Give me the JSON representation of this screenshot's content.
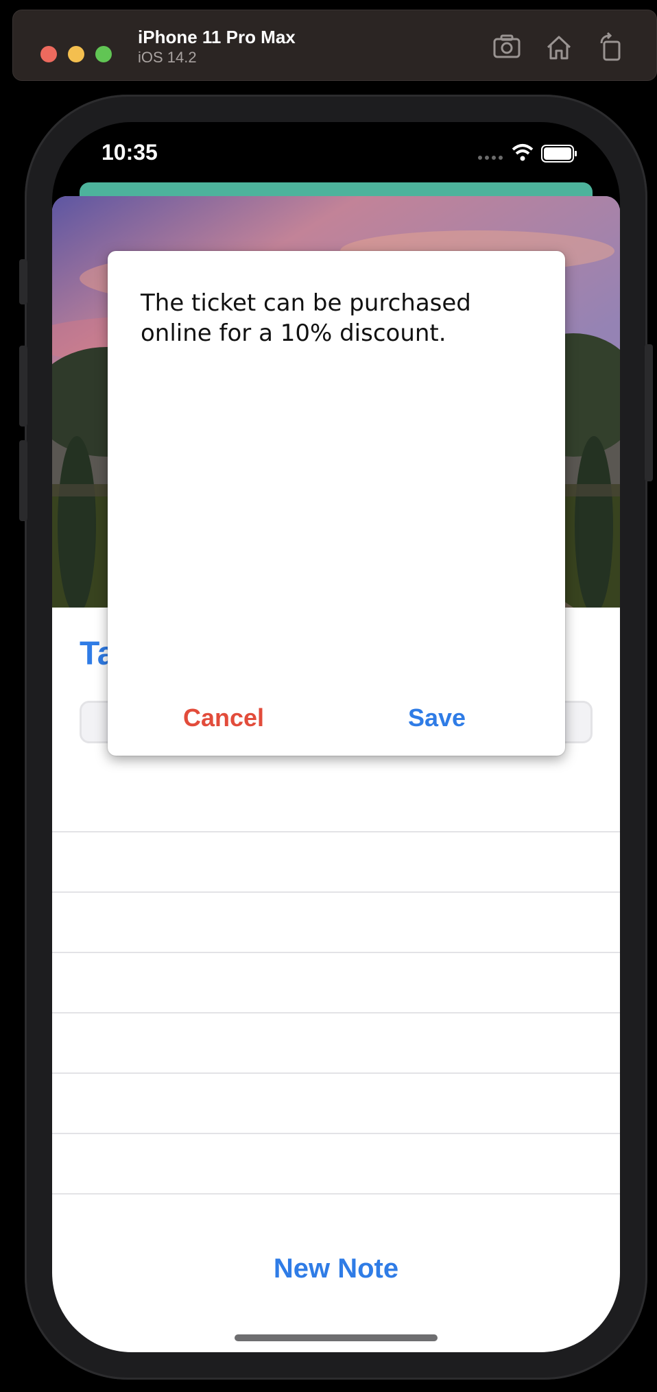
{
  "simulator": {
    "device_name": "iPhone 11 Pro Max",
    "os_version": "iOS 14.2"
  },
  "status_bar": {
    "time": "10:35"
  },
  "content": {
    "title_partial": "Ta",
    "new_note_label": "New Note"
  },
  "dialog": {
    "text": "The ticket can be purchased online for a 10% discount.",
    "cancel_label": "Cancel",
    "save_label": "Save"
  },
  "colors": {
    "accent_blue": "#2f7ce6",
    "cancel_red": "#e24c3b",
    "sheet_green": "#4db39c"
  }
}
